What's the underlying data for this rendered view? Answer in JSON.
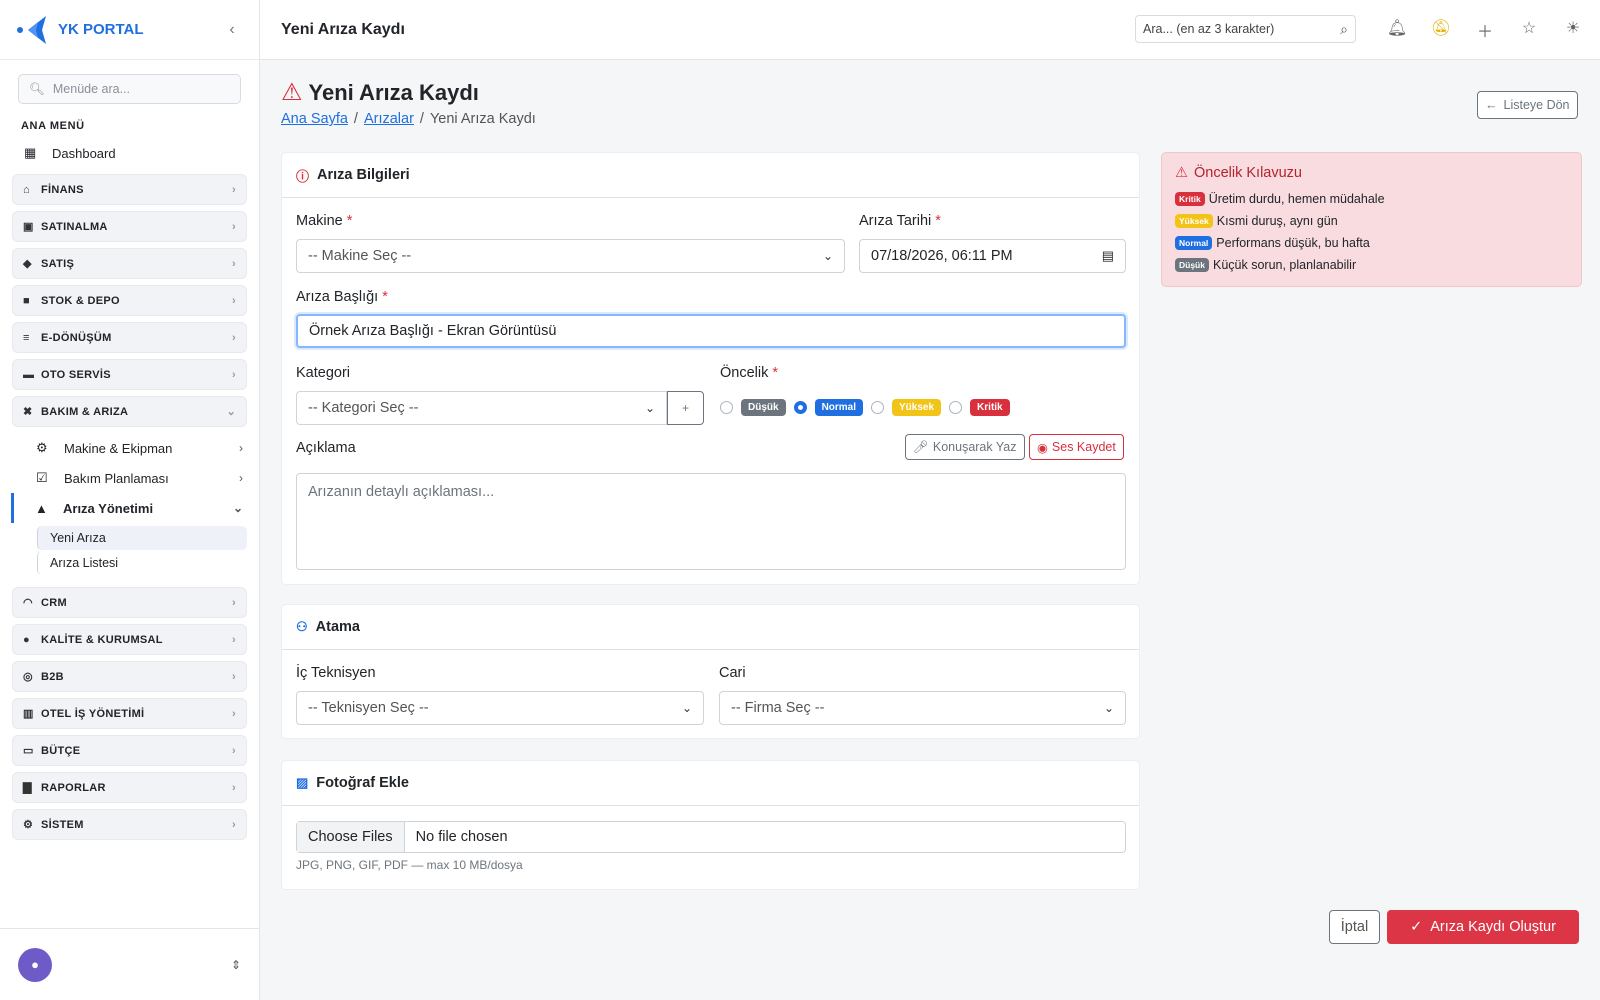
{
  "sidebar": {
    "brand": "YK PORTAL",
    "search_placeholder": "Menüde ara...",
    "menu_heading": "ANA MENÜ",
    "dashboard": "Dashboard",
    "groups_top": [
      {
        "label": "FİNANS",
        "icon": "bank-icon"
      },
      {
        "label": "SATINALMA",
        "icon": "cart-icon"
      },
      {
        "label": "SATIŞ",
        "icon": "tag-icon"
      },
      {
        "label": "STOK & DEPO",
        "icon": "box-icon"
      },
      {
        "label": "E-DÖNÜŞÜM",
        "icon": "document-icon"
      },
      {
        "label": "OTO SERVİS",
        "icon": "car-icon"
      },
      {
        "label": "BAKIM & ARIZA",
        "icon": "tools-icon"
      }
    ],
    "maintenance_items": [
      {
        "label": "Makine & Ekipman",
        "icon": "gear-icon"
      },
      {
        "label": "Bakım Planlaması",
        "icon": "calendar-icon"
      },
      {
        "label": "Arıza Yönetimi",
        "icon": "warning-icon"
      }
    ],
    "fault_leaves": [
      "Yeni Arıza",
      "Arıza Listesi"
    ],
    "groups_bottom": [
      {
        "label": "CRM",
        "icon": "headset-icon"
      },
      {
        "label": "KALİTE & KURUMSAL",
        "icon": "badge-icon"
      },
      {
        "label": "B2B",
        "icon": "globe-icon"
      },
      {
        "label": "OTEL İŞ YÖNETİMİ",
        "icon": "building-icon"
      },
      {
        "label": "BÜTÇE",
        "icon": "wallet-icon"
      },
      {
        "label": "RAPORLAR",
        "icon": "bar-chart-icon"
      },
      {
        "label": "SİSTEM",
        "icon": "settings-icon"
      }
    ]
  },
  "topbar": {
    "title": "Yeni Arıza Kaydı",
    "search_placeholder": "Ara... (en az 3 karakter)"
  },
  "page": {
    "title": "Yeni Arıza Kaydı",
    "breadcrumb": [
      "Ana Sayfa",
      "Arızalar",
      "Yeni Arıza Kaydı"
    ],
    "back_button": "Listeye Dön"
  },
  "fault_card": {
    "title": "Arıza Bilgileri",
    "machine_label": "Makine",
    "machine_value": "-- Makine Seç --",
    "date_label": "Arıza Tarihi",
    "date_value": "07/18/2026, 06:11 PM",
    "title_label": "Arıza Başlığı",
    "title_value": "Örnek Arıza Başlığı - Ekran Görüntüsü",
    "category_label": "Kategori",
    "category_value": "-- Kategori Seç --",
    "category_add": "+",
    "priority_label": "Öncelik",
    "priorities": [
      "Düşük",
      "Normal",
      "Yüksek",
      "Kritik"
    ],
    "priority_selected": "Normal",
    "description_label": "Açıklama",
    "voice_write": "Konuşarak Yaz",
    "voice_record": "Ses Kaydet",
    "description_placeholder": "Arızanın detaylı açıklaması..."
  },
  "assign_card": {
    "title": "Atama",
    "tech_label": "İç Teknisyen",
    "tech_value": "-- Teknisyen Seç --",
    "vendor_label": "Cari",
    "vendor_value": "-- Firma Seç --"
  },
  "photo_card": {
    "title": "Fotoğraf Ekle",
    "choose_button": "Choose Files",
    "file_status": "No file chosen",
    "hint": "JPG, PNG, GIF, PDF — max 10 MB/dosya"
  },
  "priority_guide": {
    "title": "Öncelik Kılavuzu",
    "rows": [
      {
        "badge": "Kritik",
        "text": "Üretim durdu, hemen müdahale"
      },
      {
        "badge": "Yüksek",
        "text": "Kısmi duruş, aynı gün"
      },
      {
        "badge": "Normal",
        "text": "Performans düşük, bu hafta"
      },
      {
        "badge": "Düşük",
        "text": "Küçük sorun, planlanabilir"
      }
    ]
  },
  "actions": {
    "cancel": "İptal",
    "submit": "Arıza Kaydı Oluştur"
  },
  "colors": {
    "accent": "#1f6fe0",
    "danger": "#dc3545",
    "warning": "#f2c418",
    "secondary": "#6c757d"
  }
}
